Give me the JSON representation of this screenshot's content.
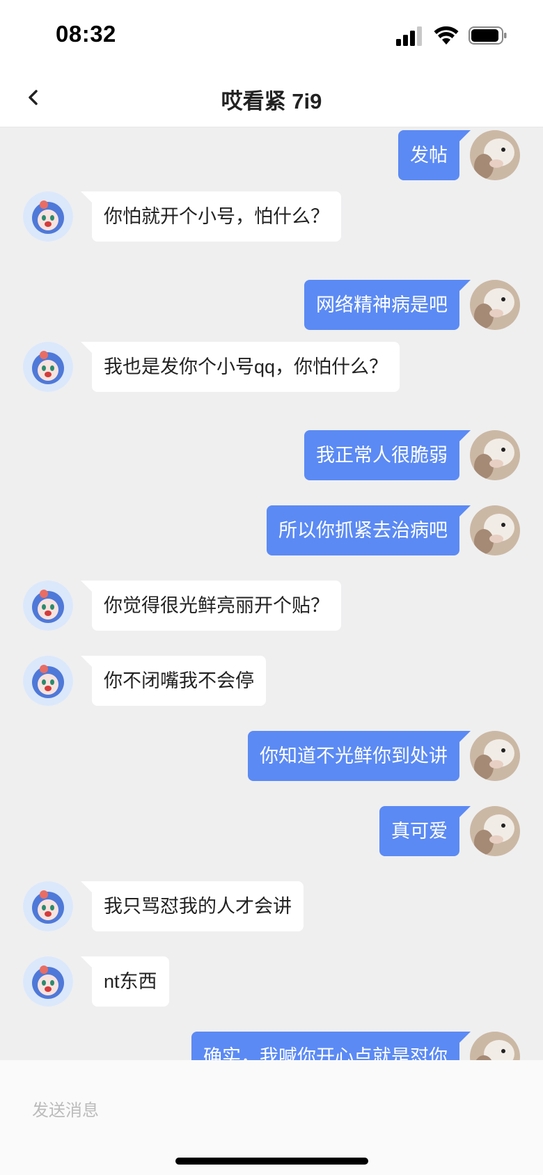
{
  "status_bar": {
    "time": "08:32",
    "icons": [
      "signal-icon",
      "wifi-icon",
      "battery-icon"
    ]
  },
  "nav": {
    "title": "哎看紧 7i9",
    "back_icon": "chevron-left-icon"
  },
  "colors": {
    "outgoing_bubble": "#5b8af4",
    "incoming_bubble": "#ffffff",
    "chat_background": "#efeff0"
  },
  "messages": [
    {
      "from": "me",
      "text": "发帖"
    },
    {
      "from": "other",
      "text": "你怕就开个小号，怕什么？"
    },
    {
      "from": "me",
      "text": "网络精神病是吧"
    },
    {
      "from": "other",
      "text": "我也是发你个小号qq，你怕什么？"
    },
    {
      "from": "me",
      "text": "我正常人很脆弱"
    },
    {
      "from": "me",
      "text": "所以你抓紧去治病吧"
    },
    {
      "from": "other",
      "text": "你觉得很光鲜亮丽开个贴？"
    },
    {
      "from": "other",
      "text": "你不闭嘴我不会停"
    },
    {
      "from": "me",
      "text": "你知道不光鲜你到处讲"
    },
    {
      "from": "me",
      "text": "真可爱"
    },
    {
      "from": "other",
      "text": "我只骂怼我的人才会讲"
    },
    {
      "from": "other",
      "text": "nt东西"
    },
    {
      "from": "me",
      "text": "确实，我喊你开心点就是怼你"
    }
  ],
  "input": {
    "placeholder": "发送消息"
  }
}
